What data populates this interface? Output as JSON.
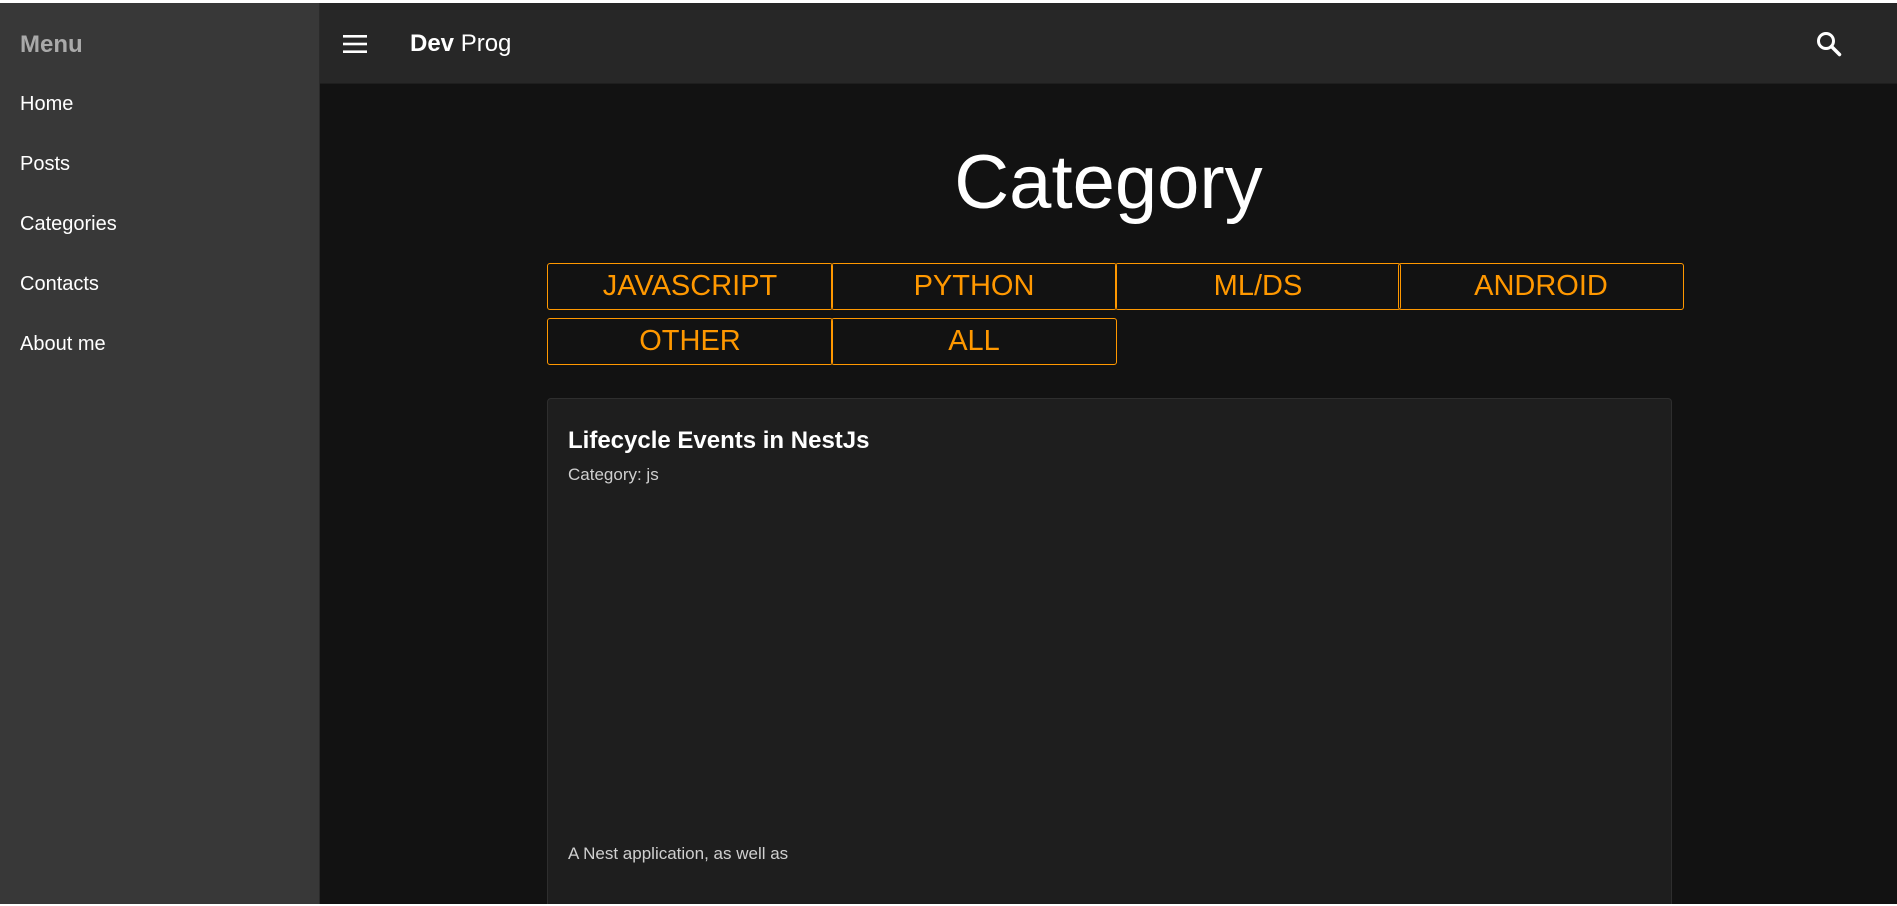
{
  "sidebar": {
    "title": "Menu",
    "items": [
      {
        "label": "Home"
      },
      {
        "label": "Posts"
      },
      {
        "label": "Categories"
      },
      {
        "label": "Contacts"
      },
      {
        "label": "About me"
      }
    ]
  },
  "topbar": {
    "menu_icon": "hamburger-icon",
    "brand_bold": "Dev",
    "brand_rest": "Prog",
    "search_icon": "search-icon"
  },
  "main": {
    "title": "Category",
    "categories": [
      {
        "label": "JAVASCRIPT"
      },
      {
        "label": "PYTHON"
      },
      {
        "label": "ML/DS"
      },
      {
        "label": "ANDROID"
      },
      {
        "label": "OTHER"
      },
      {
        "label": "ALL"
      }
    ],
    "post": {
      "title": "Lifecycle Events in NestJs",
      "category": "Category: js",
      "excerpt": "A Nest application, as well as"
    }
  },
  "colors": {
    "accent": "#ff9800",
    "background": "#121212",
    "sidebar": "#383838",
    "topbar": "#272727",
    "card": "#1e1e1e"
  }
}
